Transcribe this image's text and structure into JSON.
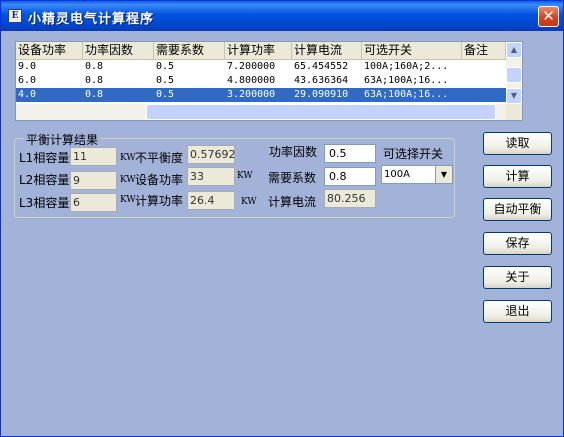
{
  "window": {
    "title": "小精灵电气计算程序",
    "icon_text": "E",
    "close_label": "✕"
  },
  "table": {
    "columns": [
      "设备功率",
      "功率因数",
      "需要系数",
      "计算功率",
      "计算电流",
      "可选开关",
      "备注"
    ],
    "rows": [
      [
        "9.0",
        "0.8",
        "0.5",
        "7.200000",
        "65.454552",
        "100A;160A;2...",
        ""
      ],
      [
        "6.0",
        "0.8",
        "0.5",
        "4.800000",
        "43.636364",
        "63A;100A;16...",
        ""
      ],
      [
        "4.0",
        "0.8",
        "0.5",
        "3.200000",
        "29.090910",
        "63A;100A;16...",
        ""
      ]
    ],
    "selected_row": 2
  },
  "group": {
    "title": "平衡计算结果",
    "l1_label": "L1相容量",
    "l1_value": "11",
    "l2_label": "L2相容量",
    "l2_value": "9",
    "l3_label": "L3相容量",
    "l3_value": "6",
    "unit_kw": "KW",
    "imbalance_label": "不平衡度",
    "imbalance_value": "0.57692",
    "equip_power_label": "设备功率",
    "equip_power_value": "33",
    "calc_power_label": "计算功率",
    "calc_power_value": "26.4",
    "calc_current_label": "计算电流",
    "calc_current_value": "80.256"
  },
  "inputs": {
    "power_factor_label": "功率因数",
    "power_factor_value": "0.5",
    "demand_label": "需要系数",
    "demand_value": "0.8",
    "switch_label": "可选择开关",
    "switch_value": "100A"
  },
  "buttons": {
    "read": "读取",
    "calc": "计算",
    "auto_balance": "自动平衡",
    "save": "保存",
    "about": "关于",
    "exit": "退出"
  }
}
